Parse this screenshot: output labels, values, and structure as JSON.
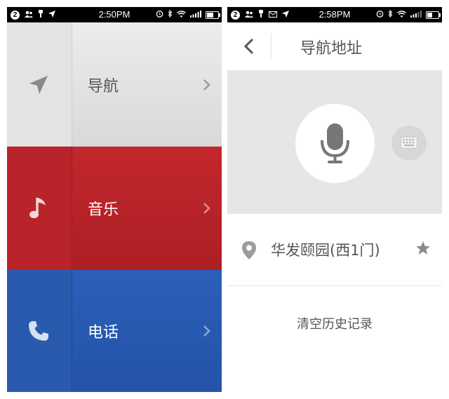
{
  "left_phone": {
    "status_bar": {
      "notification_count": "2",
      "time": "2:50PM"
    },
    "menu": [
      {
        "label": "导航",
        "icon": "navigation-arrow-icon",
        "color": "#d9d9d9"
      },
      {
        "label": "音乐",
        "icon": "music-note-icon",
        "color": "#b8242a"
      },
      {
        "label": "电话",
        "icon": "phone-handset-icon",
        "color": "#2a5aae"
      }
    ]
  },
  "right_phone": {
    "status_bar": {
      "notification_count": "2",
      "time": "2:58PM"
    },
    "header": {
      "title": "导航地址",
      "back_icon": "chevron-left-icon"
    },
    "voice": {
      "mic_icon": "microphone-icon",
      "keyboard_icon": "keyboard-icon"
    },
    "favorite": {
      "address": "华发颐园(西1门)",
      "pin_icon": "location-pin-icon",
      "star_icon": "star-icon"
    },
    "clear_history_label": "清空历史记录"
  }
}
